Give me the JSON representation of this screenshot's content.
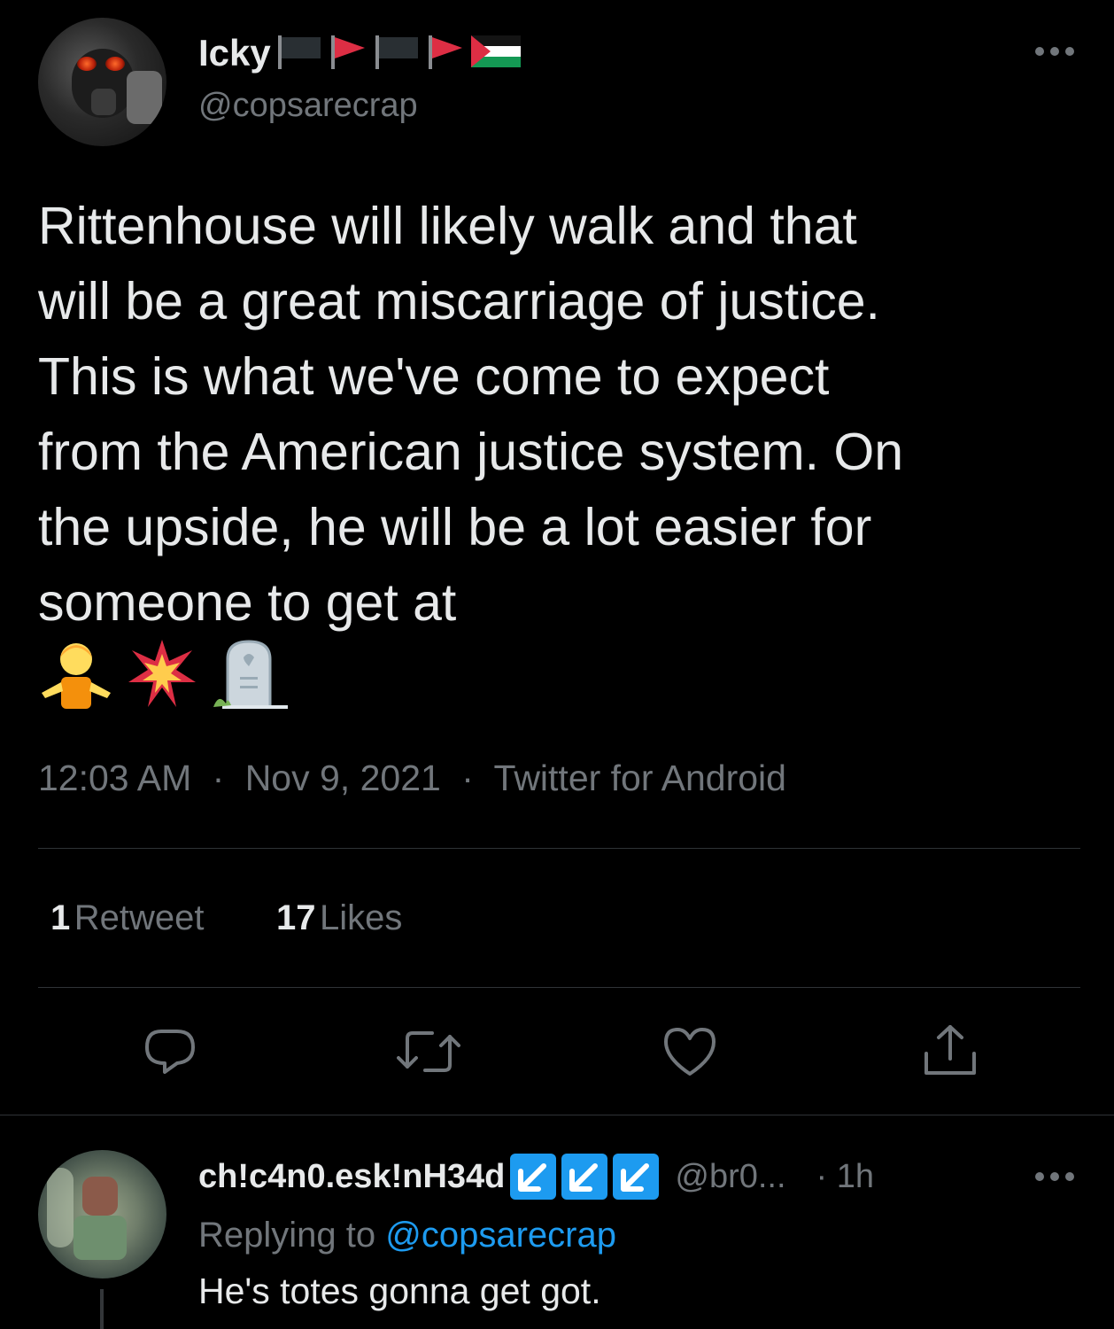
{
  "tweet": {
    "author_name": "Icky",
    "author_handle": "@copsarecrap",
    "more_icon": "more-dots-icon",
    "text": "Rittenhouse will likely walk and that\nwill be a great miscarriage of justice.\nThis is what we've come to expect\nfrom the American justice system. On\nthe upside, he will be a lot easier for\nsomeone to get at",
    "emojis": [
      "person-shrugging-emoji",
      "collision-emoji",
      "headstone-emoji"
    ],
    "time": "12:03 AM",
    "sep1": "·",
    "date": "Nov 9, 2021",
    "sep2": "·",
    "source": "Twitter for Android",
    "retweets_count": "1",
    "retweets_label": "Retweet",
    "likes_count": "17",
    "likes_label": "Likes"
  },
  "actions": [
    {
      "icon": "reply-icon"
    },
    {
      "icon": "retweet-icon"
    },
    {
      "icon": "like-heart-icon"
    },
    {
      "icon": "share-icon"
    }
  ],
  "reply": {
    "author_name": "ch!c4n0.esk!nH34d",
    "author_handle": "@br0...",
    "time": "· 1h",
    "replying_prefix": "Replying to",
    "replying_handle": "@copsarecrap",
    "text": "He's totes gonna get got."
  },
  "colors": {
    "background": "#000000",
    "text": "#e7e9ea",
    "secondary": "#71767b",
    "accent": "#1d9bf0",
    "divider": "#2f3336"
  }
}
